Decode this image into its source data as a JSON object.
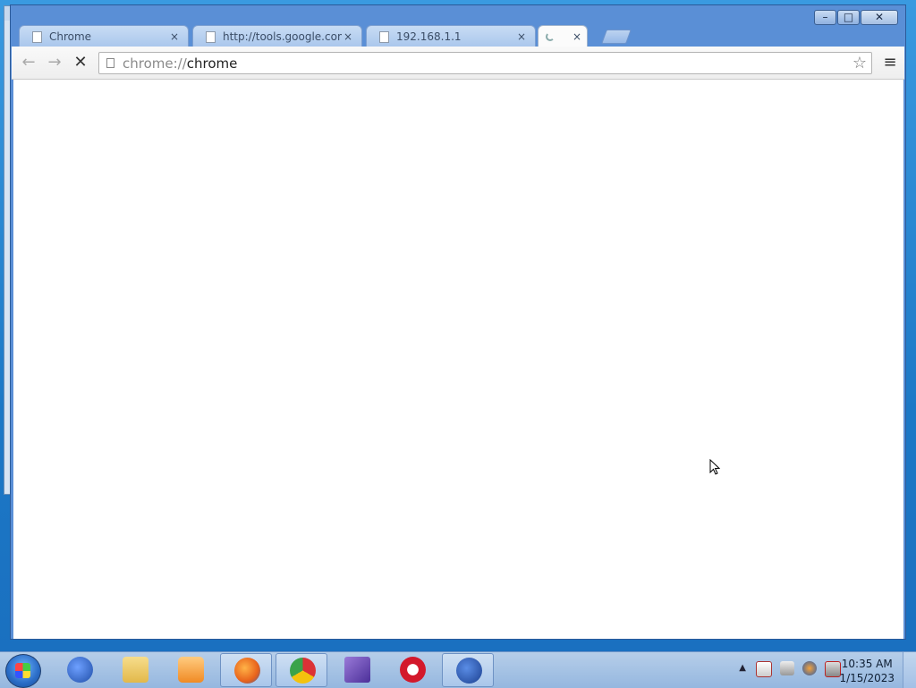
{
  "browser": {
    "tabs": [
      {
        "title": "Chrome",
        "close": "×"
      },
      {
        "title": "http://tools.google.com/",
        "close": "×"
      },
      {
        "title": "192.168.1.1",
        "close": "×"
      },
      {
        "title": "",
        "close": "×",
        "loading": true
      }
    ],
    "toolbar": {
      "back_icon": "←",
      "forward_icon": "→",
      "stop_icon": "✕",
      "url_scheme": "chrome://",
      "url_host": "chrome",
      "bookmark_icon": "☆",
      "menu_icon": "≡"
    },
    "window_controls": {
      "minimize": "–",
      "maximize": "□",
      "close": "✕"
    }
  },
  "taskbar": {
    "apps": [
      {
        "name": "ccleaner",
        "color": "#1f4ea8"
      },
      {
        "name": "file-explorer",
        "color": "#e9c46a"
      },
      {
        "name": "media-player",
        "color": "#f08a24"
      },
      {
        "name": "firefox",
        "color": "#e8621b"
      },
      {
        "name": "chrome",
        "color": "#3aa34a"
      },
      {
        "name": "visual-studio",
        "color": "#6a4bb0"
      },
      {
        "name": "opera",
        "color": "#d3182b"
      },
      {
        "name": "ccleaner-alt",
        "color": "#1b3f8f"
      }
    ],
    "tray_expand": "▲",
    "clock": {
      "time": "10:35 AM",
      "date": "1/15/2023"
    }
  }
}
